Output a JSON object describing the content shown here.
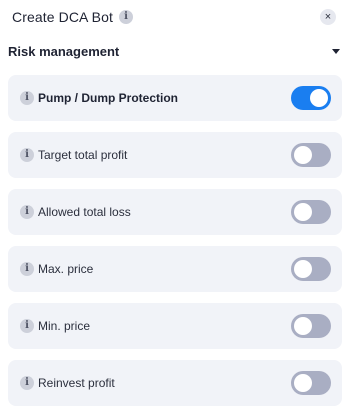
{
  "header": {
    "title": "Create DCA Bot",
    "info_glyph": "i",
    "close_glyph": "×"
  },
  "section": {
    "title": "Risk management",
    "expanded": true
  },
  "colors": {
    "toggle_on": "#1a7ef0",
    "toggle_off": "#a9aec3",
    "row_background": "#f1f3f8"
  },
  "settings": [
    {
      "label": "Pump / Dump Protection",
      "enabled": true,
      "info": "i"
    },
    {
      "label": "Target total profit",
      "enabled": false,
      "info": "i"
    },
    {
      "label": "Allowed total loss",
      "enabled": false,
      "info": "i"
    },
    {
      "label": "Max. price",
      "enabled": false,
      "info": "i"
    },
    {
      "label": "Min. price",
      "enabled": false,
      "info": "i"
    },
    {
      "label": "Reinvest profit",
      "enabled": false,
      "info": "i"
    }
  ]
}
